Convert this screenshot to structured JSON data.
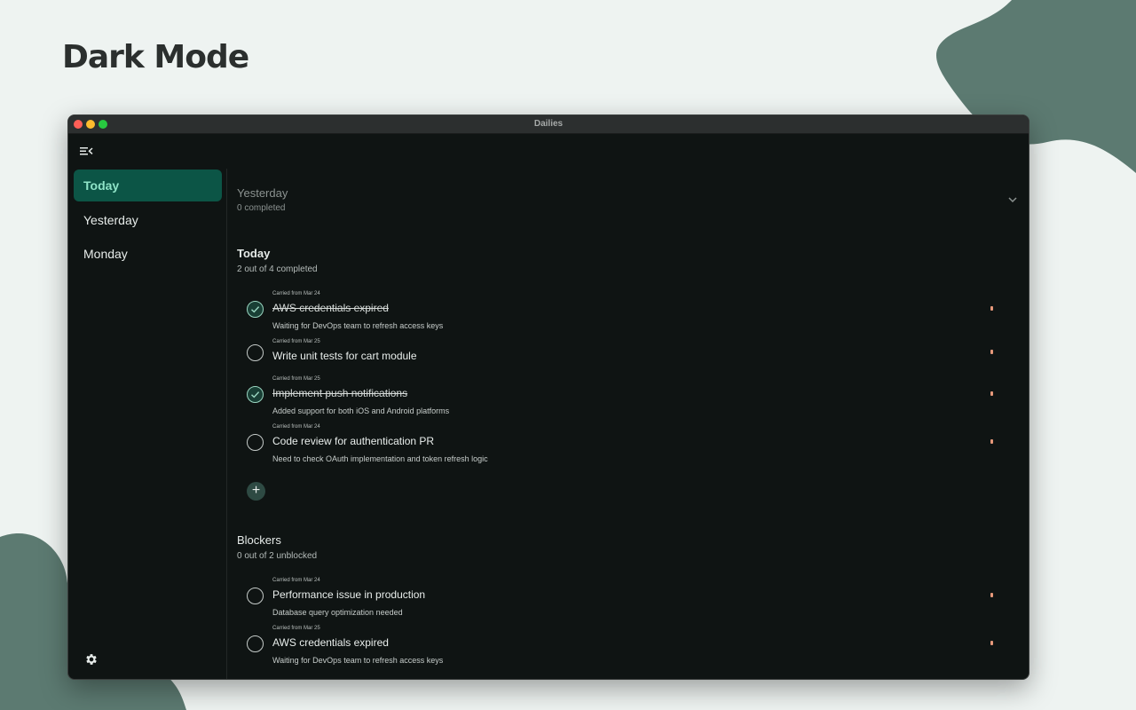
{
  "hero": {
    "title": "Dark Mode"
  },
  "window": {
    "title": "Dailies"
  },
  "sidebar": {
    "items": [
      {
        "label": "Today",
        "active": true
      },
      {
        "label": "Yesterday",
        "active": false
      },
      {
        "label": "Monday",
        "active": false
      }
    ],
    "menu_icon": "menu-collapse-icon",
    "settings_icon": "gear-icon"
  },
  "sections": {
    "yesterday": {
      "title": "Yesterday",
      "subtitle": "0 completed",
      "collapsed": true
    },
    "today": {
      "title": "Today",
      "subtitle": "2 out of 4 completed",
      "tasks": [
        {
          "carried": "Carried from Mar 24",
          "title": "AWS credentials expired",
          "desc": "Waiting for DevOps team to refresh access keys",
          "done": true
        },
        {
          "carried": "Carried from Mar 25",
          "title": "Write unit tests for cart module",
          "desc": "",
          "done": false
        },
        {
          "carried": "Carried from Mar 25",
          "title": "Implement push notifications",
          "desc": "Added support for both iOS and Android platforms",
          "done": true
        },
        {
          "carried": "Carried from Mar 24",
          "title": "Code review for authentication PR",
          "desc": "Need to check OAuth implementation and token refresh logic",
          "done": false
        }
      ],
      "add_label": "+"
    },
    "blockers": {
      "title": "Blockers",
      "subtitle": "0 out of 2 unblocked",
      "tasks": [
        {
          "carried": "Carried from Mar 24",
          "title": "Performance issue in production",
          "desc": "Database query optimization needed",
          "done": false
        },
        {
          "carried": "Carried from Mar 25",
          "title": "AWS credentials expired",
          "desc": "Waiting for DevOps team to refresh access keys",
          "done": false
        }
      ]
    }
  },
  "colors": {
    "accent": "#0c5546",
    "accent_text": "#8fe3c7",
    "window_bg": "#0f1413",
    "flag": "#e6987a",
    "blob": "#5c7a71"
  }
}
